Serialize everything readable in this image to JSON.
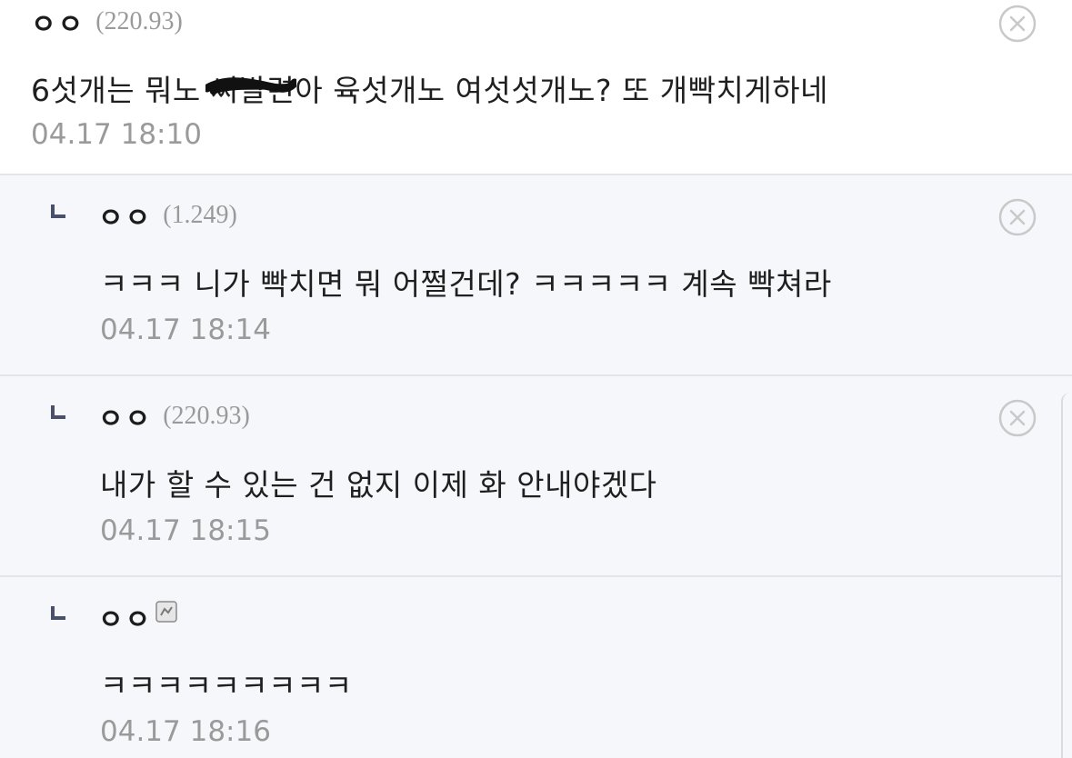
{
  "comments": [
    {
      "nickname": "ㅇㅇ",
      "ip": "(220.93)",
      "text_before": "6섯개는 뭐노 ",
      "text_censored": "씨발련",
      "text_after": "아 육섯개노 여섯섯개노? 또 개빡치게하네",
      "date": "04.17 18:10",
      "icon": "delete-circle-x"
    }
  ],
  "replies": [
    {
      "nickname": "ㅇㅇ",
      "ip": "(1.249)",
      "text": "ㅋㅋㅋ 니가 빡치면 뭐 어쩔건데? ㅋㅋㅋㅋㅋ 계속 빡쳐라",
      "date": "04.17 18:14",
      "icon": "delete-circle-x"
    },
    {
      "nickname": "ㅇㅇ",
      "ip": "(220.93)",
      "text": "내가 할 수 있는 건 없지 이제 화 안내야겠다",
      "date": "04.17 18:15",
      "icon": "delete-circle-x"
    },
    {
      "nickname": "ㅇㅇ",
      "ip": "",
      "text": "ㅋㅋㅋㅋㅋㅋㅋㅋㅋ",
      "date": "04.17 18:16",
      "icon": "member-badge"
    }
  ],
  "colors": {
    "reply_background": "#f6f7fa",
    "divider": "#e3e5ea",
    "muted_text": "#9a9a9a",
    "reply_marker": "#4a4f6a"
  }
}
